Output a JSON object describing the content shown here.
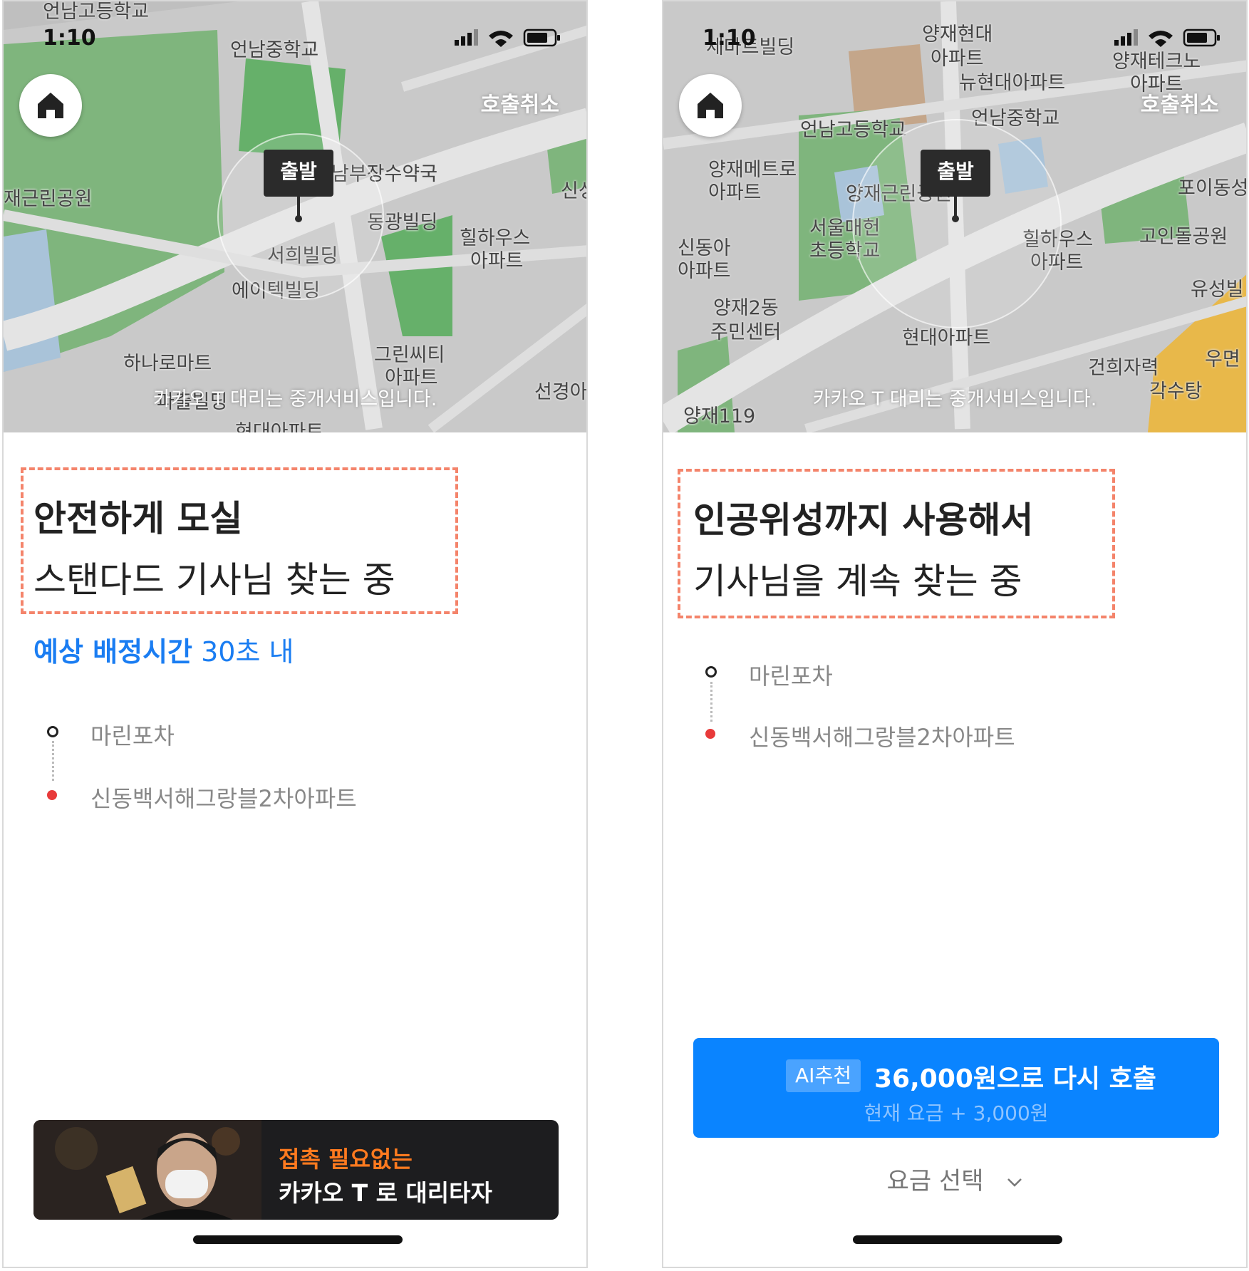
{
  "colors": {
    "accent_blue": "#1a7df2",
    "cta_blue": "#0a84ff",
    "highlight_dash": "#f4846b",
    "dest_red": "#e83a3a",
    "banner_orange": "#ff7a1f"
  },
  "left": {
    "status_time": "1:10",
    "cancel_label": "호출취소",
    "pin_label": "출발",
    "disclaimer": "카카오 T 대리는 중개서비스입니다.",
    "map_labels": [
      "언남고등학교",
      "언남중학교",
      "재근린공원",
      "남부장수약국",
      "동광빌딩",
      "서희빌딩",
      "에이텍빌딩",
      "힐하우스",
      "아파트",
      "신성",
      "하나로마트",
      "그린씨티",
      "아파트",
      "선경아",
      "현대아파트",
      "파출빌딩"
    ],
    "title_line1": "안전하게 모실",
    "title_line2": "스탠다드 기사님 찾는 중",
    "eta_bold": "예상 배정시간",
    "eta_value": "30초 내",
    "origin": "마린포차",
    "destination": "신동백서해그랑블2차아파트",
    "banner_line1": "접촉 필요없는",
    "banner_line2": "카카오 T 로 대리타자"
  },
  "right": {
    "status_time": "1:10",
    "cancel_label": "호출취소",
    "pin_label": "출발",
    "disclaimer": "카카오 T 대리는 중개서비스입니다.",
    "map_labels": [
      "세마트빌딩",
      "양재현대",
      "아파트",
      "뉴현대아파트",
      "양재테크노",
      "아파트",
      "언남고등학교",
      "언남중학교",
      "양재메트로",
      "아파트",
      "양재근린공원",
      "포이동성",
      "서울매헌",
      "초등학교",
      "신동아",
      "아파트",
      "힐하우스",
      "아파트",
      "고인돌공원",
      "양재2동",
      "주민센터",
      "유성빌",
      "현대아파트",
      "건희자력",
      "우면",
      "각수탕",
      "양재119"
    ],
    "title_line1": "인공위성까지 사용해서",
    "title_line2": "기사님을 계속 찾는 중",
    "origin": "마린포차",
    "destination": "신동백서해그랑블2차아파트",
    "ai_badge": "AI추천",
    "cta_main": "36,000원으로 다시 호출",
    "cta_sub": "현재 요금 + 3,000원",
    "fare_select": "요금 선택"
  }
}
